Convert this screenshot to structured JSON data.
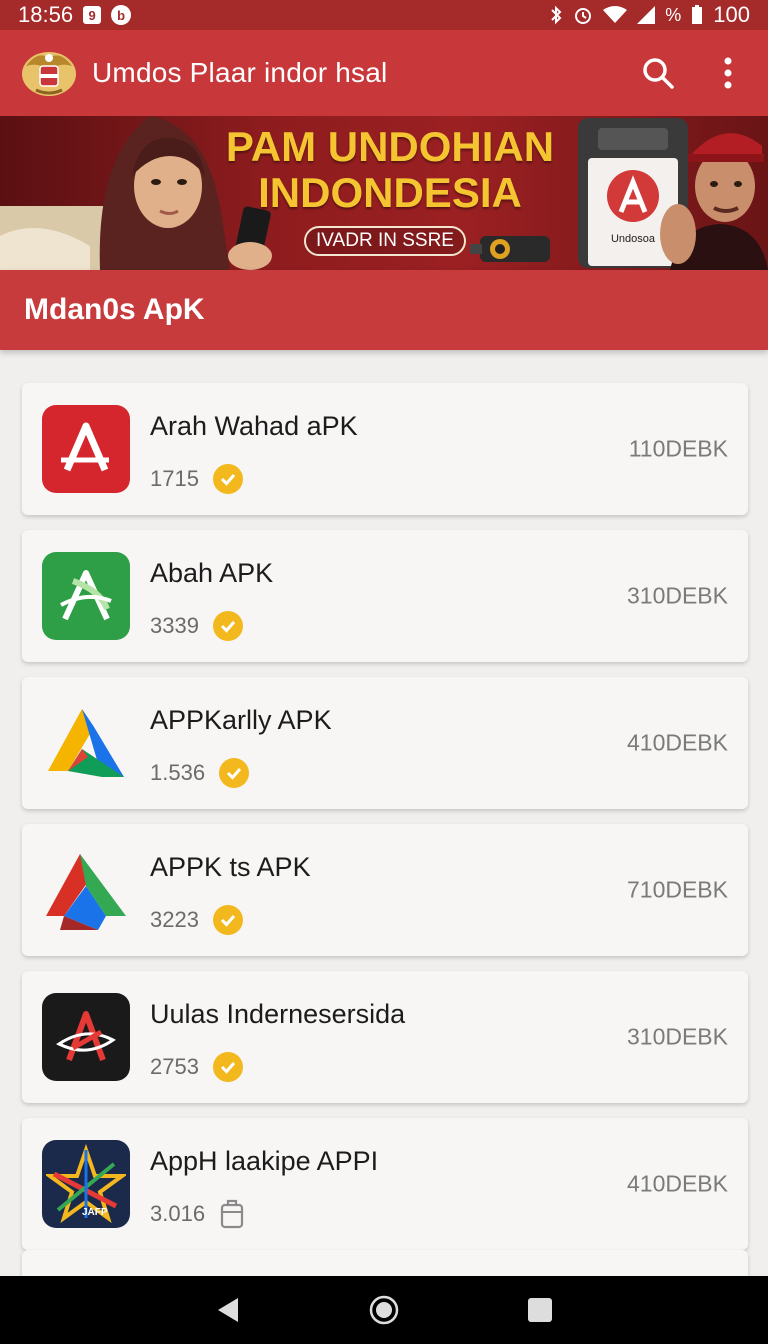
{
  "status_bar": {
    "time": "18:56",
    "notif_1": "9",
    "notif_2": "b",
    "battery_text": "100",
    "signal_text": "%"
  },
  "app_bar": {
    "title": "Umdos Plaar indor hsal",
    "icons": [
      "app-logo",
      "search-icon",
      "more-vert-icon"
    ]
  },
  "banner": {
    "headline_1": "PAM UNDOHIAN",
    "headline_2": "INDONDESIA",
    "button_label": "IVADR IN SSRE",
    "device_label": "Undosoa"
  },
  "section": {
    "title": "Mdan0s ApK"
  },
  "apps": [
    {
      "name": "Arah Wahad aPK",
      "count": "1715",
      "size": "110DEBK",
      "icon": "red-a-icon",
      "badge": "verified"
    },
    {
      "name": "Abah APK",
      "count": "3339",
      "size": "310DEBK",
      "icon": "green-a-icon",
      "badge": "verified"
    },
    {
      "name": "APPKarlly APK",
      "count": "1.536",
      "size": "410DEBK",
      "icon": "tricolor-a-icon",
      "badge": "verified"
    },
    {
      "name": "APPK ts APK",
      "count": "3223",
      "size": "710DEBK",
      "icon": "red-green-a-icon",
      "badge": "verified"
    },
    {
      "name": "Uulas Indernesersida",
      "count": "2753",
      "size": "310DEBK",
      "icon": "dark-a-icon",
      "badge": "verified"
    },
    {
      "name": "AppH laakipe APPI",
      "count": "3.016",
      "size": "410DEBK",
      "icon": "star-icon",
      "badge": "package",
      "icon_label": "JAFP"
    }
  ],
  "colors": {
    "status_bar": "#a52a2a",
    "app_bar": "#c8383a",
    "section": "#c83b3d",
    "badge": "#f2b81e",
    "background": "#f0efee"
  },
  "nav": {
    "icons": [
      "back-icon",
      "home-icon",
      "recents-icon"
    ]
  }
}
